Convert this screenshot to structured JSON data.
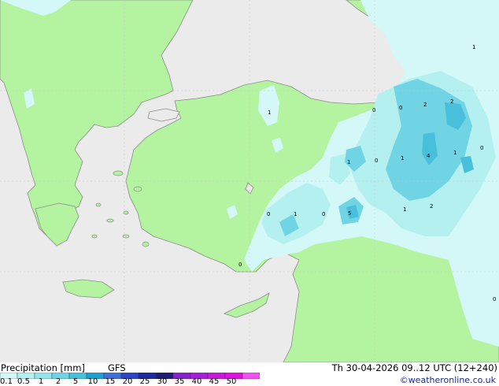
{
  "legend": {
    "title": "Precipitation [mm]",
    "model": "GFS",
    "ticks": [
      "0.1",
      "0.5",
      "1",
      "2",
      "5",
      "10",
      "15",
      "20",
      "25",
      "30",
      "35",
      "40",
      "45",
      "50"
    ],
    "colors": [
      "#d4f8f8",
      "#b4f0f0",
      "#94e4ec",
      "#70d4e4",
      "#48c0dc",
      "#1f9ed2",
      "#3f6fd6",
      "#2d44c4",
      "#1a2aa0",
      "#1c1c70",
      "#8a1fd0",
      "#a61fd8",
      "#c818d8",
      "#e010e0",
      "#f050f0"
    ]
  },
  "run": {
    "label": "Th 30-04-2026 09..12 UTC (12+240)"
  },
  "credit": "©weatheronline.co.uk",
  "map": {
    "colors": {
      "sea": "#ebebeb",
      "land": "#b4f4a0",
      "coast": "#8c8c8c",
      "border": "#8c8c8c"
    },
    "values": [
      "1",
      "1",
      "0",
      "0",
      "2",
      "2",
      "1",
      "0",
      "1",
      "4",
      "1",
      "0",
      "0",
      "1",
      "0",
      "5",
      "1",
      "2",
      "0",
      "0"
    ]
  }
}
